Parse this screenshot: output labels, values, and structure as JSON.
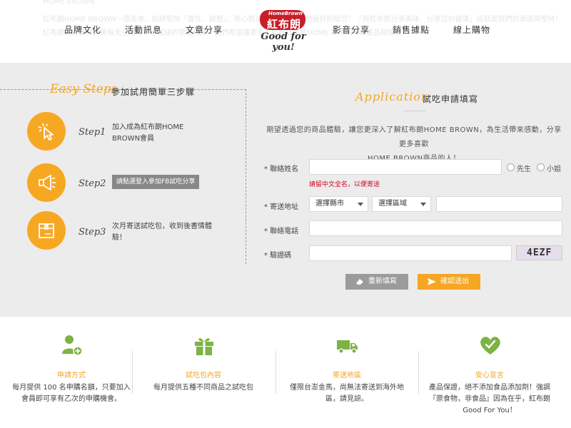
{
  "header": {
    "ghost_lines": [
      "HOME BROWN",
      "紅布朗HOME BROWN一路走來，始終堅持「實在、誠懇」，用心挑選每一份食材，把最好的給您！「與紅布朗分享美味、分享您的健康」這就是我們的承諾與堅持！",
      "紅布朗的好食材，是每天生活中不可或缺的營養來源，我們希望讓更多人認識紅布朗HOME BROWN的產品與理念！"
    ],
    "nav_left": [
      "品牌文化",
      "活動訊息",
      "文章分享"
    ],
    "nav_right": [
      "影音分享",
      "銷售據點",
      "線上購物"
    ],
    "logo": {
      "small": "HomeBrown",
      "main": "紅布朗",
      "tagline": "Good for you!"
    }
  },
  "steps_panel": {
    "script": "Easy Steps",
    "title": "參加試用簡單三步驟",
    "steps": [
      {
        "label": "Step1",
        "text_line1": "加入成為紅布朗HOME",
        "text_line2": "BROWN會員",
        "icon": "cursor-click-icon"
      },
      {
        "label": "Step2",
        "button": "請點選登入參加FB試吃分享",
        "icon": "megaphone-icon"
      },
      {
        "label": "Step3",
        "text_line1": "次月寄送試吃包，收到後書情體",
        "text_line2": "驗！",
        "icon": "package-icon"
      }
    ]
  },
  "form": {
    "script": "Application",
    "title": "試吃申請填寫",
    "desc_line1": "期望透過您的商品體驗，讓您更深入了解紅布朗HOME BROWN，為生活帶來感動，分享更多喜歡",
    "desc_line2": "HOME BROWN商品的人！",
    "name_label": "* 聯絡姓名",
    "gender_options": [
      "先生",
      "小姐"
    ],
    "name_hint": "請留中文全名，以便寄送",
    "address_label": "* 寄送地址",
    "county_select": "選擇縣市",
    "district_select": "選擇區域",
    "phone_label": "* 聯絡電話",
    "captcha_label": "* 驗證碼",
    "captcha_text": "4EZF",
    "reset_button": "重新填寫",
    "submit_button": "確認送出"
  },
  "features": [
    {
      "icon": "user-add-icon",
      "title": "申請方式",
      "line1": "每月提供 100 名申購名額，只要加入",
      "line2": "會員即可享有乙次的申購機會。"
    },
    {
      "icon": "gift-icon",
      "title": "試吃包內容",
      "line1": "每月提供五種不同商品之試吃包",
      "line2": ""
    },
    {
      "icon": "truck-icon",
      "title": "寄送地區",
      "line1": "僅限台澎金馬，尚無法寄送到海外地",
      "line2": "區，請見諒。"
    },
    {
      "icon": "heart-shield-icon",
      "title": "安心宣言",
      "line1": "產品保證，絕不添加食品添加劑！強調",
      "line2": "『原食物，非食品』因為在乎，紅布朗",
      "line3": "Good For You！"
    }
  ],
  "colors": {
    "accent": "#f5a623",
    "brand_red": "#c81e2a",
    "hint_red": "#d0021b",
    "panel_bg": "#ececec"
  }
}
